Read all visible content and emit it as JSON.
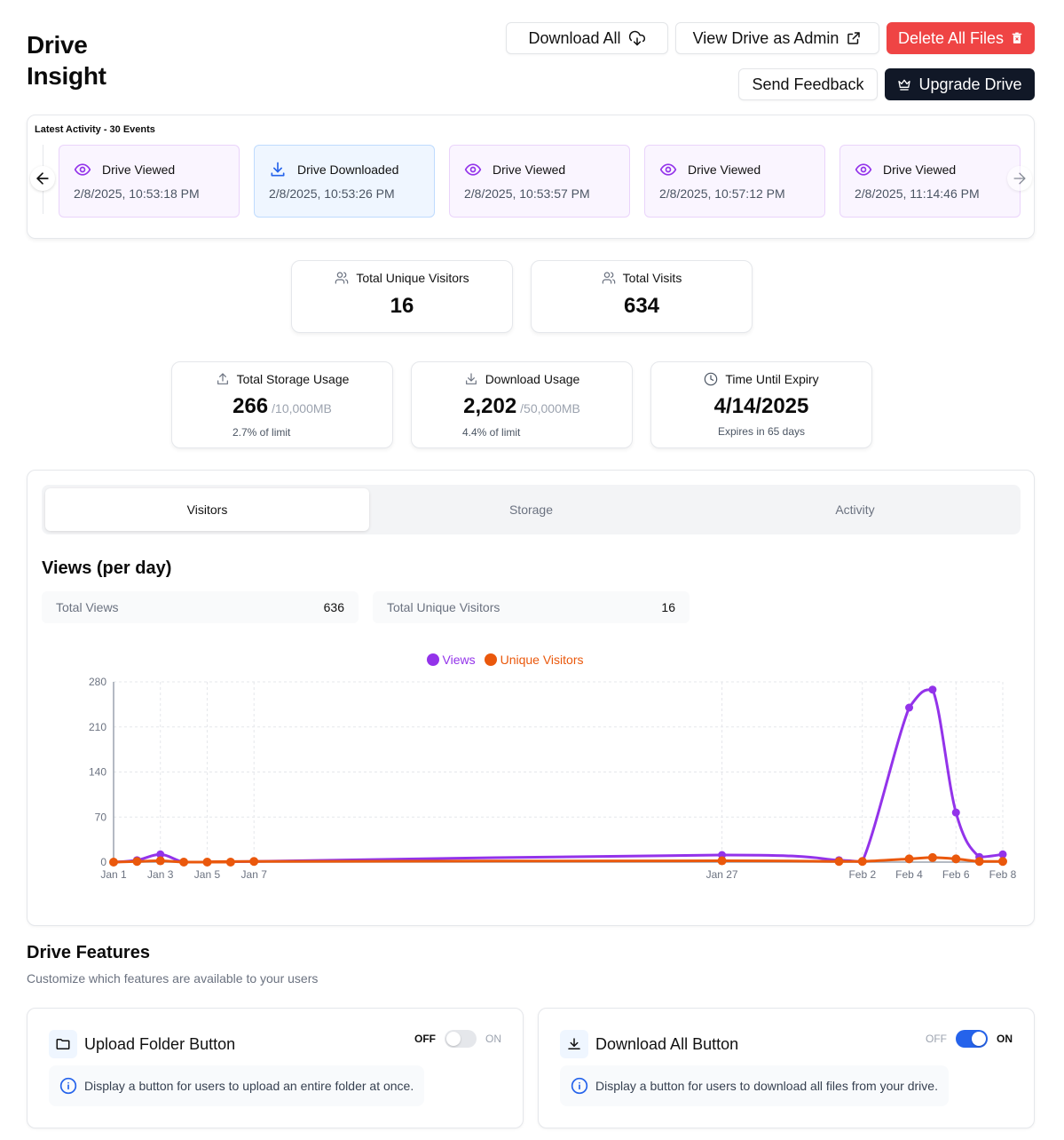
{
  "header": {
    "title": "Drive Insight",
    "buttons": {
      "download_all": "Download All",
      "view_admin": "View Drive as Admin",
      "delete_all": "Delete All Files",
      "send_feedback": "Send Feedback",
      "upgrade": "Upgrade Drive"
    }
  },
  "activity": {
    "title": "Latest Activity - 30 Events",
    "events": [
      {
        "label": "Drive Viewed",
        "time": "2/8/2025, 10:53:18 PM",
        "type": "view"
      },
      {
        "label": "Drive Downloaded",
        "time": "2/8/2025, 10:53:26 PM",
        "type": "download"
      },
      {
        "label": "Drive Viewed",
        "time": "2/8/2025, 10:53:57 PM",
        "type": "view"
      },
      {
        "label": "Drive Viewed",
        "time": "2/8/2025, 10:57:12 PM",
        "type": "view"
      },
      {
        "label": "Drive Viewed",
        "time": "2/8/2025, 11:14:46 PM",
        "type": "view"
      }
    ]
  },
  "stats": {
    "unique_visitors": {
      "label": "Total Unique Visitors",
      "value": "16"
    },
    "visits": {
      "label": "Total Visits",
      "value": "634"
    },
    "storage": {
      "label": "Total Storage Usage",
      "value": "266",
      "limit": "/10,000MB",
      "sub": "2.7% of limit",
      "percent": 2.7
    },
    "download": {
      "label": "Download Usage",
      "value": "2,202",
      "limit": "/50,000MB",
      "sub": "4.4% of limit",
      "percent": 4.4
    },
    "expiry": {
      "label": "Time Until Expiry",
      "value": "4/14/2025",
      "sub": "Expires in 65 days"
    }
  },
  "tabs": [
    {
      "label": "Visitors",
      "active": true
    },
    {
      "label": "Storage",
      "active": false
    },
    {
      "label": "Activity",
      "active": false
    }
  ],
  "chart_section": {
    "title": "Views (per day)",
    "metrics": [
      {
        "label": "Total Views",
        "value": "636"
      },
      {
        "label": "Total Unique Visitors",
        "value": "16"
      }
    ]
  },
  "colors": {
    "views": "#9333ea",
    "unique": "#ea580c",
    "danger": "#ef4444",
    "dark": "#111827",
    "toggle_on": "#2563eb"
  },
  "chart_data": {
    "type": "line",
    "title": "Views (per day)",
    "xlabel": "",
    "ylabel": "",
    "ylim": [
      0,
      280
    ],
    "yticks": [
      0,
      70,
      140,
      210,
      280
    ],
    "grid": true,
    "legend": "top-center",
    "x_day_offset": [
      0,
      1,
      2,
      3,
      4,
      5,
      6,
      26,
      31,
      32,
      34,
      35,
      36,
      37,
      38
    ],
    "x": [
      "Jan 1",
      "Jan 2",
      "Jan 3",
      "Jan 4",
      "Jan 5",
      "Jan 6",
      "Jan 7",
      "Jan 27",
      "Feb 1",
      "Feb 2",
      "Feb 4",
      "Feb 5",
      "Feb 6",
      "Feb 7",
      "Feb 8"
    ],
    "xticks": [
      {
        "label": "Jan 1",
        "day": 0
      },
      {
        "label": "Jan 3",
        "day": 2
      },
      {
        "label": "Jan 5",
        "day": 4
      },
      {
        "label": "Jan 7",
        "day": 6
      },
      {
        "label": "Jan 27",
        "day": 26
      },
      {
        "label": "Feb 2",
        "day": 32
      },
      {
        "label": "Feb 4",
        "day": 34
      },
      {
        "label": "Feb 6",
        "day": 36
      },
      {
        "label": "Feb 8",
        "day": 38
      }
    ],
    "series": [
      {
        "name": "Views",
        "color": "#9333ea",
        "values": [
          0,
          3,
          12,
          0,
          0,
          0,
          1,
          11,
          3,
          1,
          240,
          268,
          77,
          8,
          12
        ]
      },
      {
        "name": "Unique Visitors",
        "color": "#ea580c",
        "values": [
          0,
          1,
          2,
          0,
          0,
          0,
          1,
          2,
          1,
          1,
          5,
          7,
          5,
          1,
          1
        ]
      }
    ]
  },
  "features": {
    "title": "Drive Features",
    "subtitle": "Customize which features are available to your users",
    "off_label": "OFF",
    "on_label": "ON",
    "items": [
      {
        "name": "Upload Folder Button",
        "description": "Display a button for users to upload an entire folder at once.",
        "enabled": false
      },
      {
        "name": "Download All Button",
        "description": "Display a button for users to download all files from your drive.",
        "enabled": true
      }
    ]
  }
}
